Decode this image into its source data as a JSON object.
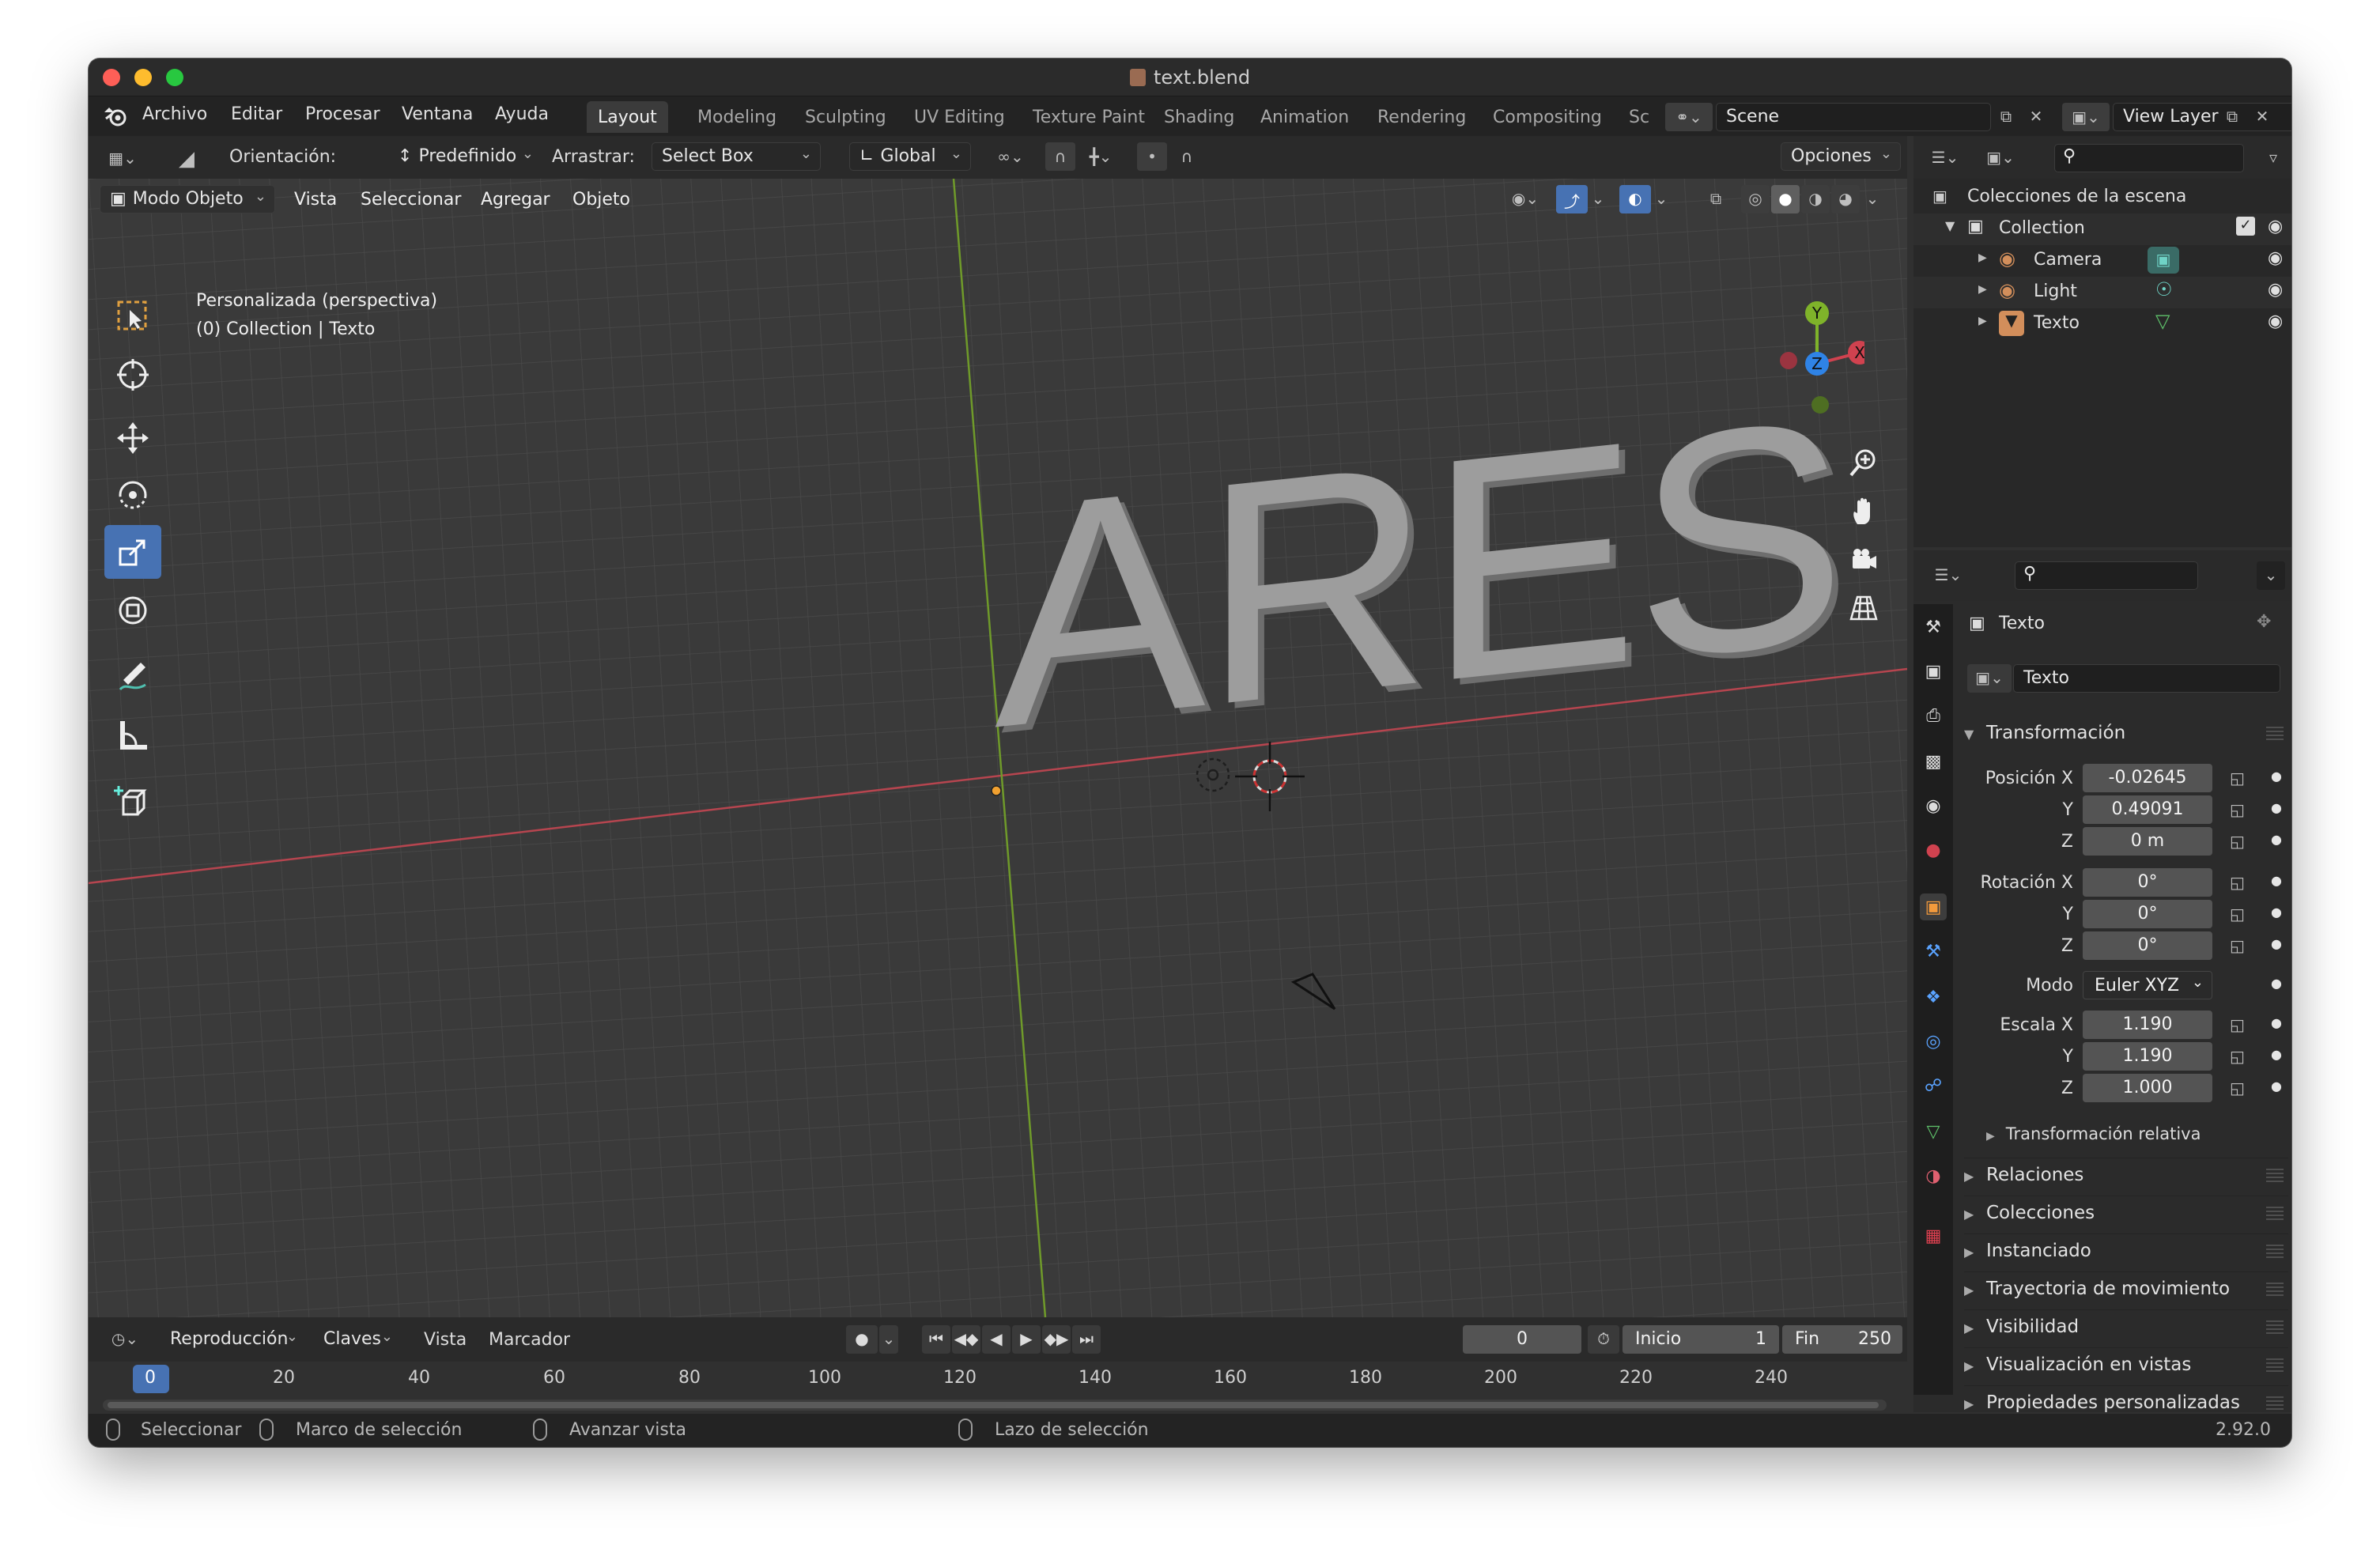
{
  "window": {
    "title": "text.blend"
  },
  "menu": {
    "items": [
      "Archivo",
      "Editar",
      "Procesar",
      "Ventana",
      "Ayuda"
    ]
  },
  "workspaces": {
    "tabs": [
      "Layout",
      "Modeling",
      "Sculpting",
      "UV Editing",
      "Texture Paint",
      "Shading",
      "Animation",
      "Rendering",
      "Compositing",
      "Sc"
    ],
    "active": "Layout"
  },
  "scene": {
    "name": "Scene",
    "view_layer": "View Layer"
  },
  "tool_header": {
    "orientation_label": "Orientación:",
    "orientation_value": "Predefinido",
    "drag_label": "Arrastrar:",
    "drag_value": "Select Box",
    "transform_orientation": "Global",
    "options_label": "Opciones"
  },
  "viewport_header": {
    "mode": "Modo Objeto",
    "menus": [
      "Vista",
      "Seleccionar",
      "Agregar",
      "Objeto"
    ]
  },
  "viewport": {
    "view_name": "Personalizada (perspectiva)",
    "collection_info": "(0) Collection | Texto",
    "text_object": "ARES",
    "gizmo_axes": {
      "x": "X",
      "y": "Y",
      "z": "Z"
    }
  },
  "outliner": {
    "root": "Colecciones de la escena",
    "collection": "Collection",
    "objects": [
      {
        "name": "Camera",
        "icon": "camera-data-icon",
        "color": "#d28e5b"
      },
      {
        "name": "Light",
        "icon": "light-data-icon",
        "color": "#d28e5b"
      },
      {
        "name": "Texto",
        "icon": "mesh-data-icon",
        "color": "#d28e5b"
      }
    ]
  },
  "properties": {
    "object_name": "Texto",
    "datablock": "Texto",
    "transform_title": "Transformación",
    "location": {
      "label": "Posición X",
      "x": "-0.02645",
      "y": "0.49091",
      "z": "0 m"
    },
    "rotation": {
      "label": "Rotación X",
      "x": "0°",
      "y": "0°",
      "z": "0°"
    },
    "mode": {
      "label": "Modo",
      "value": "Euler XYZ"
    },
    "scale": {
      "label": "Escala X",
      "x": "1.190",
      "y": "1.190",
      "z": "1.000"
    },
    "axis_y": "Y",
    "axis_z": "Z",
    "delta_transform": "Transformación relativa",
    "panels": [
      "Relaciones",
      "Colecciones",
      "Instanciado",
      "Trayectoria de movimiento",
      "Visibilidad",
      "Visualización en vistas",
      "Propiedades personalizadas"
    ]
  },
  "timeline": {
    "menus": [
      "Reproducción",
      "Claves",
      "Vista",
      "Marcador"
    ],
    "current_frame": "0",
    "start_label": "Inicio",
    "start": "1",
    "end_label": "Fin",
    "end": "250",
    "ticks": [
      "0",
      "20",
      "40",
      "60",
      "80",
      "100",
      "120",
      "140",
      "160",
      "180",
      "200",
      "220",
      "240"
    ]
  },
  "statusbar": {
    "select": "Seleccionar",
    "box_select": "Marco de selección",
    "rotate_view": "Avanzar vista",
    "lasso": "Lazo de selección",
    "version": "2.92.0"
  },
  "colors": {
    "accent": "#4772b3",
    "axis_x": "#d0424f",
    "axis_y": "#7fb32a",
    "axis_z": "#2f83e6",
    "origin": "#f0a030"
  }
}
